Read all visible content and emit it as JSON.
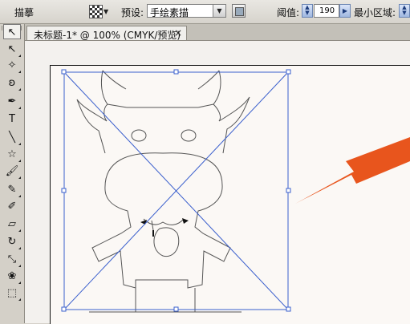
{
  "control_bar": {
    "tool_name": "描摹",
    "preset_label": "预设:",
    "preset_value": "手绘素描",
    "threshold_label": "阈值:",
    "threshold_value": "190",
    "min_area_label": "最小区域:"
  },
  "document_tab": {
    "title": "未标题-1* @ 100% (CMYK/预览)",
    "close_glyph": "×"
  },
  "tools": [
    {
      "name": "selection-tool",
      "glyph": "↖"
    },
    {
      "name": "direct-selection-tool",
      "glyph": "↖"
    },
    {
      "name": "magic-wand-tool",
      "glyph": "✧"
    },
    {
      "name": "lasso-tool",
      "glyph": "ʚ"
    },
    {
      "name": "pen-tool",
      "glyph": "✒"
    },
    {
      "name": "type-tool",
      "glyph": "T"
    },
    {
      "name": "line-tool",
      "glyph": "╲"
    },
    {
      "name": "star-tool",
      "glyph": "☆"
    },
    {
      "name": "brush-tool",
      "glyph": "🖌"
    },
    {
      "name": "pencil-tool",
      "glyph": "✎"
    },
    {
      "name": "blob-brush-tool",
      "glyph": "✐"
    },
    {
      "name": "eraser-tool",
      "glyph": "▱"
    },
    {
      "name": "rotate-tool",
      "glyph": "↻"
    },
    {
      "name": "scale-tool",
      "glyph": "⤡"
    },
    {
      "name": "warp-tool",
      "glyph": "❀"
    },
    {
      "name": "free-transform-tool",
      "glyph": "⬚"
    }
  ],
  "colors": {
    "accent_arrow": "#e8551d",
    "selection_blue": "#3a5fcd",
    "trace_line": "#555555"
  }
}
